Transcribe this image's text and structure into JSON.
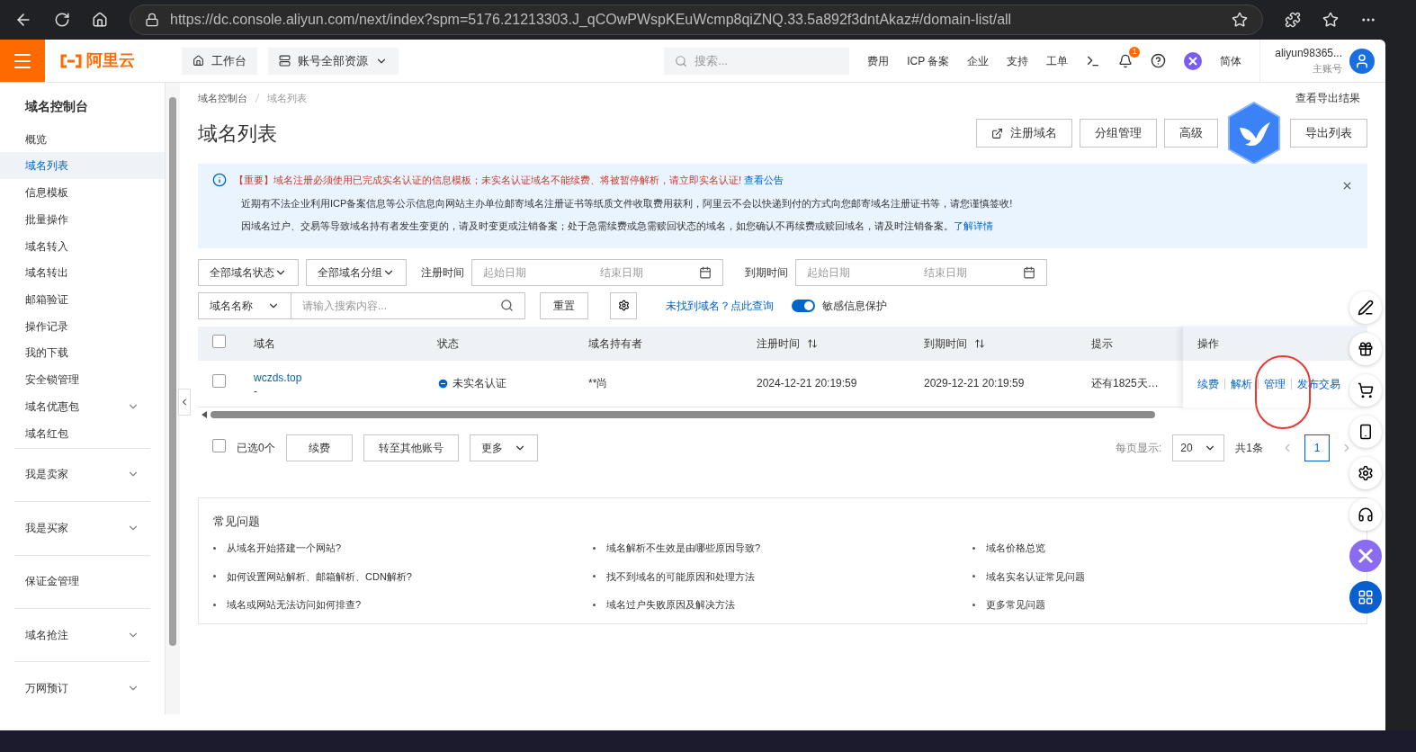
{
  "browser": {
    "url": "https://dc.console.aliyun.com/next/index?spm=5176.21213303.J_qCOwPWspKEuWcmp8qiZNQ.33.5a892f3dntAkaz#/domain-list/all"
  },
  "header": {
    "logo": "阿里云",
    "workbench": "工作台",
    "resources": "账号全部资源",
    "search_placeholder": "搜索...",
    "links": [
      "费用",
      "ICP 备案",
      "企业",
      "支持",
      "工单"
    ],
    "notification_count": "1",
    "language": "简体",
    "account": "aliyun98365...",
    "account_role": "主账号"
  },
  "sidebar": {
    "title": "域名控制台",
    "items": [
      {
        "label": "概览",
        "selected": false,
        "expandable": false
      },
      {
        "label": "域名列表",
        "selected": true,
        "expandable": false
      },
      {
        "label": "信息模板",
        "selected": false,
        "expandable": false
      },
      {
        "label": "批量操作",
        "selected": false,
        "expandable": false
      },
      {
        "label": "域名转入",
        "selected": false,
        "expandable": false
      },
      {
        "label": "域名转出",
        "selected": false,
        "expandable": false
      },
      {
        "label": "邮箱验证",
        "selected": false,
        "expandable": false
      },
      {
        "label": "操作记录",
        "selected": false,
        "expandable": false
      },
      {
        "label": "我的下载",
        "selected": false,
        "expandable": false
      },
      {
        "label": "安全锁管理",
        "selected": false,
        "expandable": false
      },
      {
        "label": "域名优惠包",
        "selected": false,
        "expandable": true
      },
      {
        "label": "域名红包",
        "selected": false,
        "expandable": false
      }
    ],
    "sections": [
      {
        "label": "我是卖家",
        "expandable": true
      },
      {
        "label": "我是买家",
        "expandable": true
      },
      {
        "label": "保证金管理",
        "expandable": false
      },
      {
        "label": "域名抢注",
        "expandable": true
      },
      {
        "label": "万网预订",
        "expandable": true
      }
    ]
  },
  "breadcrumb": [
    "域名控制台",
    "域名列表"
  ],
  "export_results": "查看导出结果",
  "page_title": "域名列表",
  "actions": [
    "注册域名",
    "分组管理",
    "高级",
    "导出列表"
  ],
  "notice": {
    "important": "【重要】域名注册必须使用已完成实名认证的信息模板；未实名认证域名不能续费、将被暂停解析，请立即实名认证!",
    "important_link": "查看公告",
    "line_2": "近期有不法企业利用ICP备案信息等公示信息向网站主办单位邮寄域名注册证书等纸质文件收取费用获利，阿里云不会以快递到付的方式向您邮寄域名注册证书等，请您谨慎签收!",
    "line_3": "因域名过户、交易等导致域名持有者发生变更的，请及时变更或注销备案；处于急需续费或急需赎回状态的域名，如您确认不再续费或赎回域名，请及时注销备案。",
    "line_3_link": "了解详情"
  },
  "filters": {
    "status": "全部域名状态",
    "group": "全部域名分组",
    "reg_label": "注册时间",
    "reg_start": "起始日期",
    "reg_end": "结束日期",
    "exp_label": "到期时间",
    "exp_start": "起始日期",
    "exp_end": "结束日期",
    "field": "域名名称",
    "search_placeholder": "请输入搜索内容...",
    "reset": "重置",
    "not_found_link": "未找到域名？点此查询",
    "privacy_toggle": {
      "label": "敏感信息保护",
      "on": true
    }
  },
  "table": {
    "select_all_checked": false,
    "columns": [
      "域名",
      "状态",
      "域名持有者",
      "注册时间",
      "到期时间",
      "提示",
      "操作"
    ],
    "rows": [
      {
        "checked": false,
        "domain": "wczds.top",
        "domain_sub": "-",
        "status": "未实名认证",
        "owner": "**尚",
        "registered": "2024-12-21 20:19:59",
        "expires": "2029-12-21 20:19:59",
        "hint": "还有1825天…",
        "operations": [
          "续费",
          "解析",
          "管理",
          "发布交易"
        ]
      }
    ]
  },
  "footer_bar": {
    "select_all_checked": false,
    "selected_count": "已选0个",
    "buttons": [
      "续费",
      "转至其他账号",
      "更多"
    ],
    "page_size_label": "每页显示:",
    "page_size": "20",
    "total": "共1条",
    "current_page": "1"
  },
  "faq": {
    "title": "常见问题",
    "items": [
      "从域名开始搭建一个网站?",
      "域名解析不生效是由哪些原因导致?",
      "域名价格总览",
      "如何设置网站解析、邮箱解析、CDN解析?",
      "找不到域名的可能原因和处理方法",
      "域名实名认证常见问题",
      "域名或网站无法访问如何排查?",
      "域名过户失败原因及解决方法",
      "更多常见问题"
    ]
  }
}
